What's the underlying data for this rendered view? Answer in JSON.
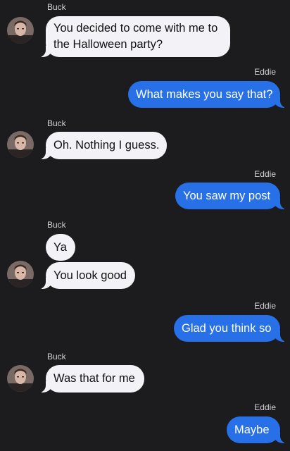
{
  "colors": {
    "background": "#1c1c1e",
    "incoming_bubble": "#f2f2f7",
    "outgoing_bubble": "#2870e8",
    "sender_label": "#d1d1d6"
  },
  "conversation": [
    {
      "sender": "Buck",
      "direction": "incoming",
      "lines": [
        "You decided to come with me to",
        "the Halloween party?"
      ]
    },
    {
      "sender": "Eddie",
      "direction": "outgoing",
      "lines": [
        "What makes you say that?"
      ]
    },
    {
      "sender": "Buck",
      "direction": "incoming",
      "lines": [
        "Oh. Nothing I guess."
      ]
    },
    {
      "sender": "Eddie",
      "direction": "outgoing",
      "lines": [
        "You saw my post"
      ]
    },
    {
      "sender": "Buck",
      "direction": "incoming",
      "lines": [
        "Ya"
      ]
    },
    {
      "sender": "Buck",
      "direction": "incoming",
      "lines": [
        "You look good"
      ]
    },
    {
      "sender": "Eddie",
      "direction": "outgoing",
      "lines": [
        "Glad you think so"
      ]
    },
    {
      "sender": "Buck",
      "direction": "incoming",
      "lines": [
        "Was that for me"
      ]
    },
    {
      "sender": "Eddie",
      "direction": "outgoing",
      "lines": [
        "Maybe"
      ]
    }
  ],
  "avatar_icon": "avatar-photo-icon"
}
